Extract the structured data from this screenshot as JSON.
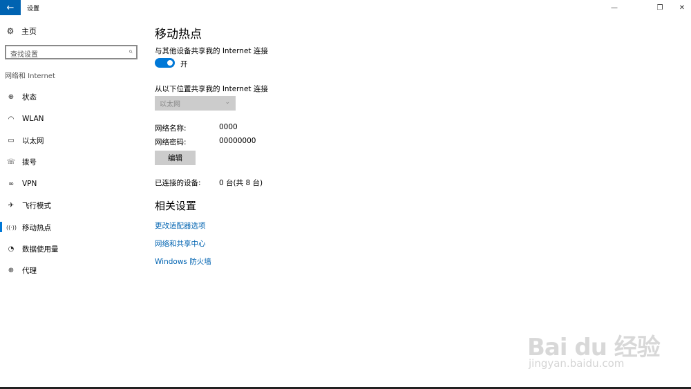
{
  "titlebar": {
    "back_icon": "←",
    "title": "设置",
    "minimize": "—",
    "maximize": "❐",
    "close": "✕"
  },
  "sidebar": {
    "home": {
      "icon": "⚙",
      "label": "主页"
    },
    "search": {
      "placeholder": "查找设置",
      "icon": "⌕"
    },
    "section": "网络和 Internet",
    "items": [
      {
        "icon": "⊕",
        "label": "状态"
      },
      {
        "icon": "◠",
        "label": "WLAN"
      },
      {
        "icon": "▭",
        "label": "以太网"
      },
      {
        "icon": "☏",
        "label": "拨号"
      },
      {
        "icon": "∞",
        "label": "VPN"
      },
      {
        "icon": "✈",
        "label": "飞行模式"
      },
      {
        "icon": "((·))",
        "label": "移动热点"
      },
      {
        "icon": "◔",
        "label": "数据使用量"
      },
      {
        "icon": "⊕",
        "label": "代理"
      }
    ]
  },
  "main": {
    "title": "移动热点",
    "share_label": "与其他设备共享我的 Internet 连接",
    "toggle_state": "开",
    "share_from_label": "从以下位置共享我的 Internet 连接",
    "share_from_value": "以太网",
    "chevron": "⌄",
    "network_name_label": "网络名称:",
    "network_name_value": "0000",
    "network_password_label": "网络密码:",
    "network_password_value": "00000000",
    "edit_button": "编辑",
    "connected_label": "已连接的设备:",
    "connected_value": "0 台(共 8 台)",
    "related_title": "相关设置",
    "links": [
      "更改适配器选项",
      "网络和共享中心",
      "Windows 防火墙"
    ]
  },
  "watermark": {
    "logo": "Bai du 经验",
    "url": "jingyan.baidu.com"
  },
  "colors": {
    "accent": "#0078d7",
    "titlebar_back": "#0063b1",
    "link": "#0063b1",
    "control_gray": "#cccccc"
  }
}
